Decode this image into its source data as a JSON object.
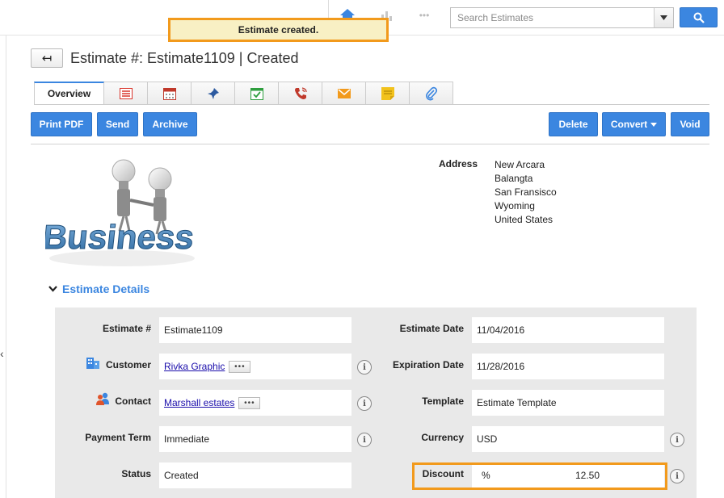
{
  "toast": {
    "message": "Estimate created."
  },
  "search": {
    "placeholder": "Search Estimates"
  },
  "header": {
    "back_symbol": "↤",
    "title": "Estimate #: Estimate1109 | Created"
  },
  "tabs": [
    {
      "label": "Overview",
      "icon": "overview"
    },
    {
      "label": "",
      "icon": "list-icon",
      "color": "#d9342b"
    },
    {
      "label": "",
      "icon": "calendar-icon",
      "color": "#c0392b"
    },
    {
      "label": "",
      "icon": "pin-icon",
      "color": "#2c5aa0"
    },
    {
      "label": "",
      "icon": "task-icon",
      "color": "#2e9e3e"
    },
    {
      "label": "",
      "icon": "phone-icon",
      "color": "#c0392b"
    },
    {
      "label": "",
      "icon": "mail-icon",
      "color": "#f29a1c"
    },
    {
      "label": "",
      "icon": "note-icon",
      "color": "#f2c21c"
    },
    {
      "label": "",
      "icon": "attachment-icon",
      "color": "#3b86e0"
    }
  ],
  "actions": {
    "print_pdf": "Print PDF",
    "send": "Send",
    "archive": "Archive",
    "delete": "Delete",
    "convert": "Convert",
    "void": "Void"
  },
  "address": {
    "label": "Address",
    "lines": [
      "New Arcara",
      "Balangta",
      "San Fransisco",
      "Wyoming",
      "United States"
    ]
  },
  "section": {
    "title": "Estimate Details"
  },
  "fields": {
    "estimate_no": {
      "label": "Estimate #",
      "value": "Estimate1109"
    },
    "customer": {
      "label": "Customer",
      "value": "Rivka Graphic"
    },
    "contact": {
      "label": "Contact",
      "value": "Marshall estates"
    },
    "payment_term": {
      "label": "Payment Term",
      "value": "Immediate"
    },
    "status": {
      "label": "Status",
      "value": "Created"
    },
    "estimate_date": {
      "label": "Estimate Date",
      "value": "11/04/2016"
    },
    "expiration_date": {
      "label": "Expiration Date",
      "value": "11/28/2016"
    },
    "template": {
      "label": "Template",
      "value": "Estimate Template"
    },
    "currency": {
      "label": "Currency",
      "value": "USD"
    },
    "discount": {
      "label": "Discount",
      "unit": "%",
      "value": "12.50"
    }
  },
  "misc": {
    "dots": "•••",
    "info": "i",
    "image_word": "Business"
  },
  "colors": {
    "accent": "#3b86e0",
    "highlight": "#f29a1c",
    "toast_bg": "#f8f0c4"
  }
}
